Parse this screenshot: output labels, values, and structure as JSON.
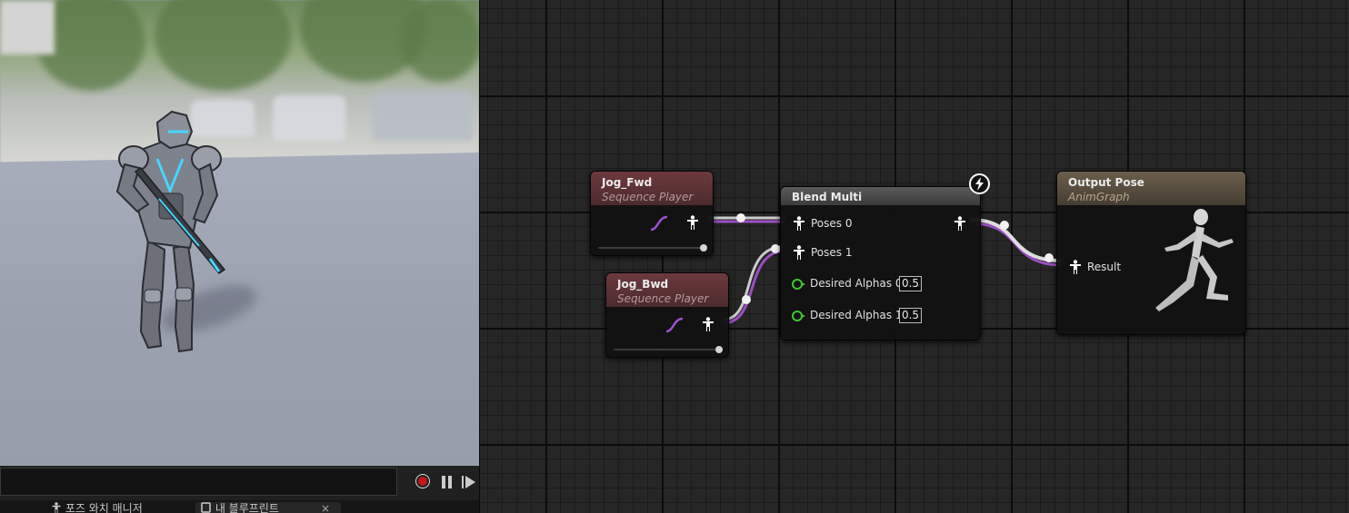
{
  "viewport": {
    "bottom_tabs": [
      {
        "label": "포즈 와치 매니저",
        "icon": "pose-watch-icon"
      },
      {
        "label": "내 블루프린트",
        "icon": "blueprint-icon",
        "close": "×"
      }
    ],
    "colors": {
      "record": "#c8161d",
      "floor": "#9ba1af"
    }
  },
  "graph": {
    "nodes": {
      "jog_fwd": {
        "title": "Jog_Fwd",
        "subtitle": "Sequence Player"
      },
      "jog_bwd": {
        "title": "Jog_Bwd",
        "subtitle": "Sequence Player"
      },
      "blend_multi": {
        "title": "Blend Multi",
        "poses": [
          "Poses 0",
          "Poses 1"
        ],
        "alphas": [
          {
            "label": "Desired Alphas 0",
            "value": "0.5"
          },
          {
            "label": "Desired Alphas 1",
            "value": "0.5"
          }
        ]
      },
      "output_pose": {
        "title": "Output Pose",
        "subtitle": "AnimGraph",
        "pin": "Result"
      }
    },
    "colors": {
      "wire": "#9a4fc2",
      "float_pin": "#3ec42e",
      "sequence_header": "#6d3a3e",
      "output_header": "#6b5e4c"
    }
  }
}
